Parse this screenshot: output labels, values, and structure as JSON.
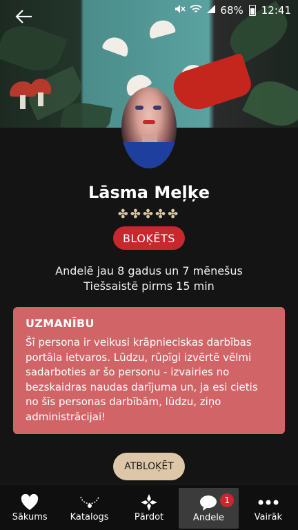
{
  "status_bar": {
    "battery": "68%",
    "time": "12:41"
  },
  "profile": {
    "name": "Lāsma Meļķe",
    "stars": "✤✤✤✤✤",
    "status_badge": "BLOĶĒTS",
    "member_since": "Andelē jau 8 gadus un 7 mēnešus",
    "last_online": "Tiešsaistē pirms 15 min"
  },
  "warning": {
    "title": "UZMANĪBU",
    "text": "Šī persona ir veikusi krāpnieciskas darbības portāla ietvaros. Lūdzu, rūpīgi izvērtē vēlmi sadarboties ar šo personu - izvairies no bezskaidras naudas darījuma un, ja esi cietis no šīs personas darbībām, lūdzu, ziņo administrācijai!"
  },
  "unblock_button": "ATBLOĶĒT",
  "nav": {
    "items": [
      {
        "label": "Sākums",
        "icon": "heart-icon"
      },
      {
        "label": "Katalogs",
        "icon": "necklace-icon"
      },
      {
        "label": "Pārdot",
        "icon": "diamond-flower-icon"
      },
      {
        "label": "Andele",
        "icon": "chat-bubble-icon",
        "badge": "1"
      },
      {
        "label": "Vairāk",
        "icon": "more-dots-icon"
      }
    ]
  },
  "colors": {
    "background": "#141414",
    "blocked_red": "#c8282d",
    "warning_bg": "#d16467",
    "unblock_bg": "#ddc7a8"
  }
}
